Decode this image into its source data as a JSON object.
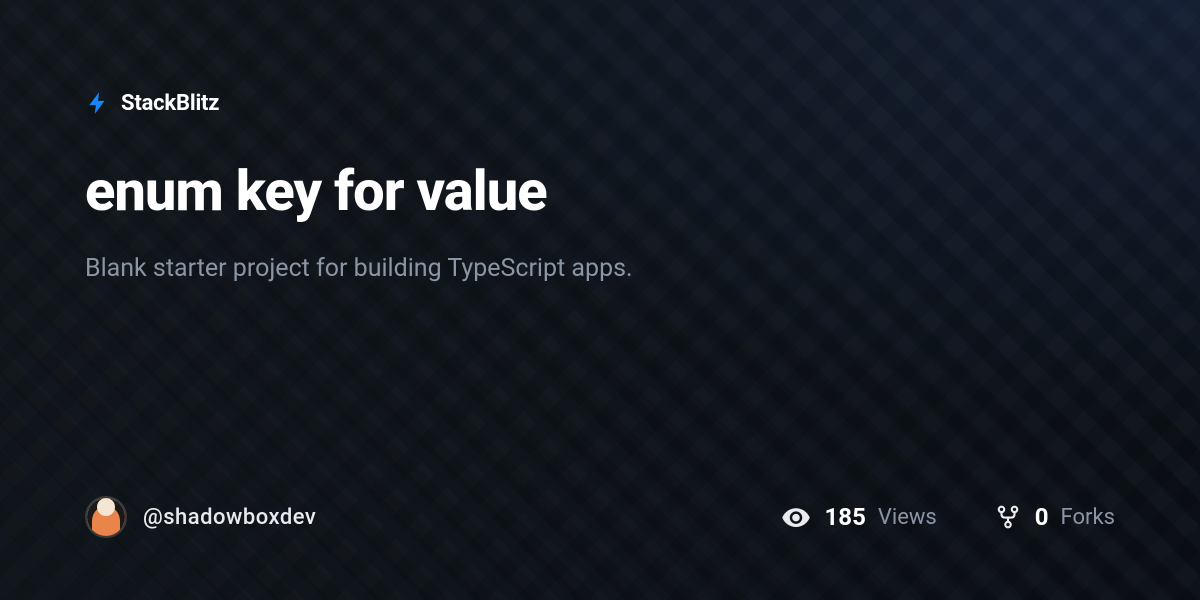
{
  "brand": {
    "name": "StackBlitz",
    "accent_color": "#1389fd"
  },
  "project": {
    "title": "enum key for value",
    "description": "Blank starter project for building TypeScript apps."
  },
  "author": {
    "username": "@shadowboxdev"
  },
  "stats": {
    "views": {
      "count": "185",
      "label": "Views"
    },
    "forks": {
      "count": "0",
      "label": "Forks"
    }
  }
}
